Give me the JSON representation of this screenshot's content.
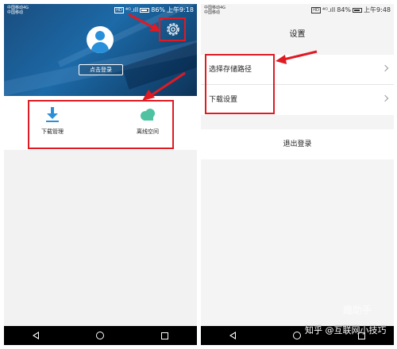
{
  "left_phone": {
    "status": {
      "carrier_line1": "中国移动4G",
      "carrier_line2": "中国移动",
      "badge": "HD",
      "signal": "⁴ᴳ.ıll",
      "battery": "86%",
      "time": "上午9:18"
    },
    "login_button": "点击登录",
    "features": [
      {
        "label": "下载管理",
        "icon": "download-icon"
      },
      {
        "label": "离线空间",
        "icon": "cloud-icon"
      }
    ],
    "settings_icon": "gear-icon"
  },
  "right_phone": {
    "status": {
      "carrier_line1": "中国移动4G",
      "carrier_line2": "中国移动",
      "badge": "HD",
      "signal": "⁴ᴳ.ıll",
      "battery": "84%",
      "time": "上午9:48"
    },
    "header_title": "设置",
    "menu_items": [
      {
        "label": "选择存储路径"
      },
      {
        "label": "下载设置"
      }
    ],
    "logout_label": "退出登录"
  },
  "watermark": "知乎 @互联网小技巧",
  "corner_mark": "趣助手",
  "colors": {
    "annotation": "#e01a22",
    "accent": "#2a8fd9",
    "offline_icon": "#4fc3a1"
  }
}
